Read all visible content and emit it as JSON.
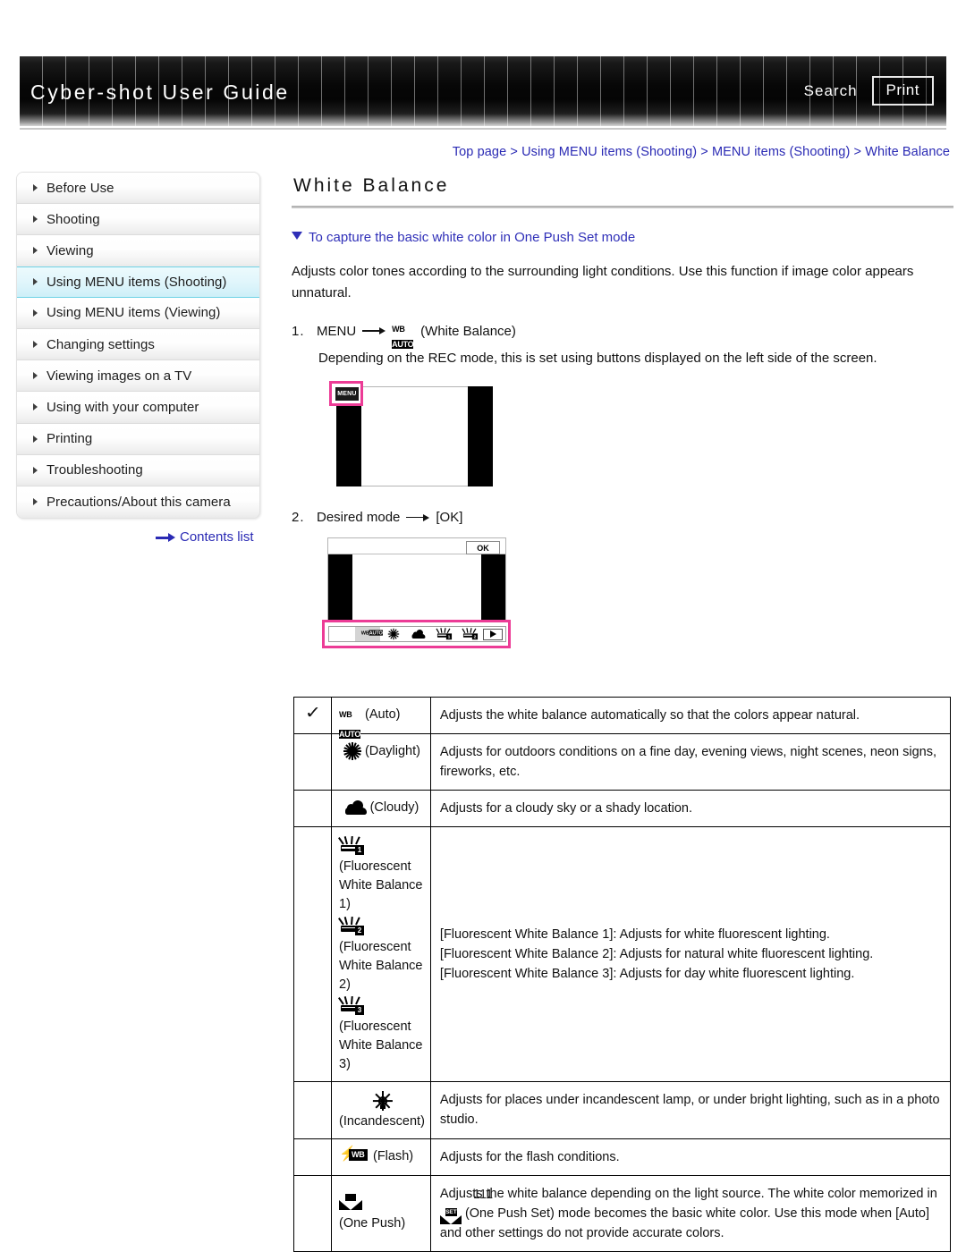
{
  "header": {
    "title": "Cyber-shot User Guide",
    "search_label": "Search",
    "print_label": "Print"
  },
  "breadcrumb": {
    "text": "Top page > Using MENU items (Shooting) > MENU items (Shooting) > White Balance"
  },
  "sidebar": {
    "items": [
      {
        "label": "Before Use",
        "active": false
      },
      {
        "label": "Shooting",
        "active": false
      },
      {
        "label": "Viewing",
        "active": false
      },
      {
        "label": "Using MENU items (Shooting)",
        "active": true
      },
      {
        "label": "Using MENU items (Viewing)",
        "active": false
      },
      {
        "label": "Changing settings",
        "active": false
      },
      {
        "label": "Viewing images on a TV",
        "active": false
      },
      {
        "label": "Using with your computer",
        "active": false
      },
      {
        "label": "Printing",
        "active": false
      },
      {
        "label": "Troubleshooting",
        "active": false
      },
      {
        "label": "Precautions/About this camera",
        "active": false
      }
    ],
    "contents_link": "Contents list"
  },
  "main": {
    "page_title": "White Balance",
    "jump_link": "To capture the basic white color in One Push Set mode",
    "intro": "Adjusts color tones according to the surrounding light conditions. Use this function if image color appears unnatural.",
    "step1": {
      "number": "1.",
      "label": "MENU",
      "icon_label": "(White Balance)",
      "icon_wb_top": "WB",
      "icon_wb_bottom": "AUTO",
      "sub": "Depending on the REC mode, this is set using buttons displayed on the left side of the screen."
    },
    "step2": {
      "number": "2.",
      "label": "Desired mode",
      "target": "[OK]"
    }
  },
  "diagram1": {
    "menu_button_label": "MENU",
    "highlight_color": "#ec3c96"
  },
  "diagram2": {
    "ok_button_label": "OK",
    "highlight_color": "#ec3c96",
    "bottom_icons": [
      "wb-auto-icon",
      "daylight-icon",
      "cloudy-icon",
      "fluorescent-1-icon",
      "fluorescent-2-icon",
      "play-arrow-icon"
    ]
  },
  "table": {
    "rows": [
      {
        "checked": true,
        "check_glyph": "✓",
        "icon": "wb-auto-icon",
        "icon_top": "WB",
        "icon_bottom": "AUTO",
        "mode_label": "(Auto)",
        "desc": [
          "Adjusts the white balance automatically so that the colors appear natural."
        ]
      },
      {
        "checked": false,
        "check_glyph": "",
        "icon": "daylight-icon",
        "mode_label": "(Daylight)",
        "desc": [
          "Adjusts for outdoors conditions on a fine day, evening views, night scenes, neon signs, fireworks, etc."
        ]
      },
      {
        "checked": false,
        "check_glyph": "",
        "icon": "cloudy-icon",
        "mode_label": "(Cloudy)",
        "desc": [
          "Adjusts for a cloudy sky or a shady location."
        ]
      },
      {
        "checked": false,
        "check_glyph": "",
        "icon": "fluorescent-group-icon",
        "mode_labels": [
          "(Fluorescent White Balance 1)",
          "(Fluorescent White Balance 2)",
          "(Fluorescent White Balance 3)"
        ],
        "mode_numbers": [
          "1",
          "2",
          "3"
        ],
        "desc": [
          "[Fluorescent White Balance 1]: Adjusts for white fluorescent lighting.",
          "[Fluorescent White Balance 2]: Adjusts for natural white fluorescent lighting.",
          "[Fluorescent White Balance 3]: Adjusts for day white fluorescent lighting."
        ]
      },
      {
        "checked": false,
        "check_glyph": "",
        "icon": "incandescent-icon",
        "mode_label": "(Incandescent)",
        "desc": [
          "Adjusts for places under incandescent lamp, or under bright lighting, such as in a photo studio."
        ]
      },
      {
        "checked": false,
        "check_glyph": "",
        "icon": "flash-wb-icon",
        "icon_wb": "WB",
        "mode_label": "(Flash)",
        "desc": [
          "Adjusts for the flash conditions."
        ]
      },
      {
        "checked": false,
        "check_glyph": "",
        "icon": "one-push-icon",
        "mode_label": "(One Push)",
        "desc_part1": "Adjusts the white balance depending on the light source. The white color memorized in",
        "desc_part2": "(One Push Set) mode becomes the basic white color. Use this mode when [Auto] and other settings do not provide accurate colors.",
        "set_icon_label": "SET"
      }
    ]
  },
  "footer": {
    "page_number": "111"
  }
}
